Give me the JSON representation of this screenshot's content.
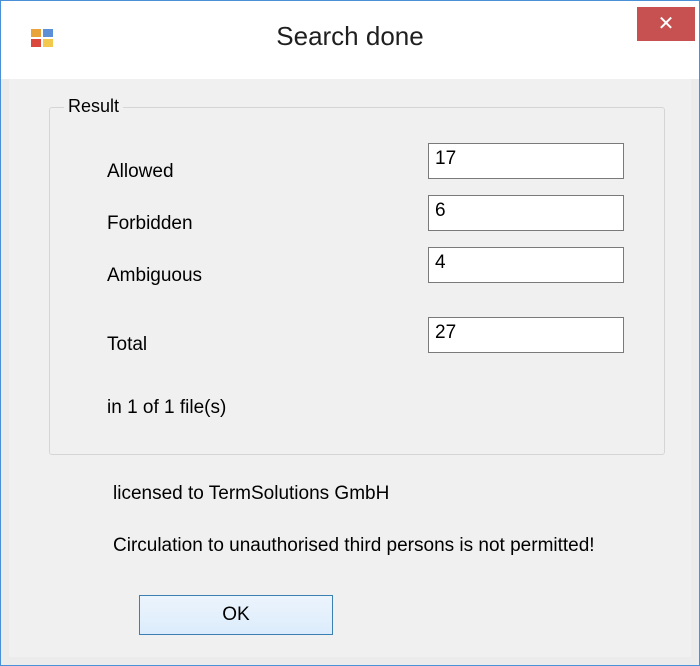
{
  "window": {
    "title": "Search done",
    "close_glyph": "✕",
    "icon": "app-icon"
  },
  "result": {
    "group_title": "Result",
    "allowed_label": "Allowed",
    "allowed_value": "17",
    "forbidden_label": "Forbidden",
    "forbidden_value": "6",
    "ambiguous_label": "Ambiguous",
    "ambiguous_value": "4",
    "total_label": "Total",
    "total_value": "27",
    "files_text": "in 1 of 1 file(s)"
  },
  "footer": {
    "license_text": "licensed to TermSolutions GmbH",
    "circulation_text": "Circulation to unauthorised third persons is not permitted!",
    "ok_label": "OK"
  },
  "colors": {
    "close_button": "#c75050",
    "window_border": "#4a90d9",
    "ok_border": "#3c7fb1"
  }
}
